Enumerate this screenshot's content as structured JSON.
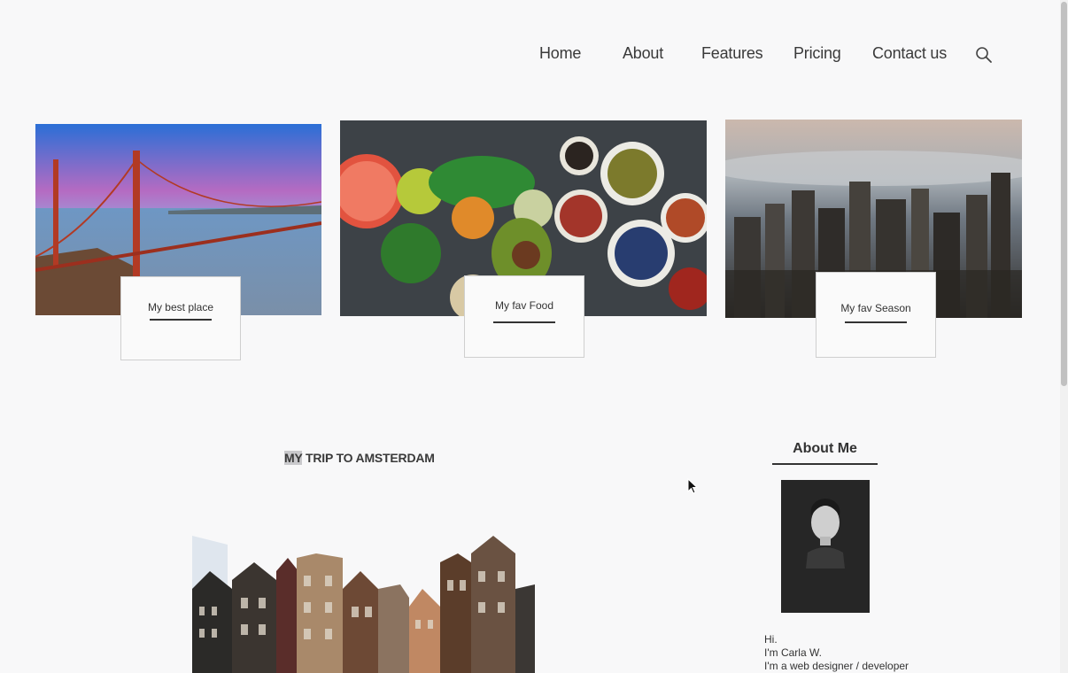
{
  "nav": {
    "home": "Home",
    "about": "About",
    "features": "Features",
    "pricing": "Pricing",
    "contact": "Contact us",
    "search_icon": "search-icon"
  },
  "cards": [
    {
      "caption": "My best place",
      "image": "golden-gate-bridge"
    },
    {
      "caption": "My fav Food",
      "image": "vegetables-and-spices"
    },
    {
      "caption": "My fav Season",
      "image": "foggy-city-skyline"
    }
  ],
  "post": {
    "title_highlight": "MY",
    "title_rest": " TRIP TO AMSTERDAM",
    "image": "amsterdam-canal-houses"
  },
  "about": {
    "heading": "About Me",
    "bio": [
      "Hi.",
      "I'm Carla W.",
      "I'm a web designer / developer"
    ]
  }
}
